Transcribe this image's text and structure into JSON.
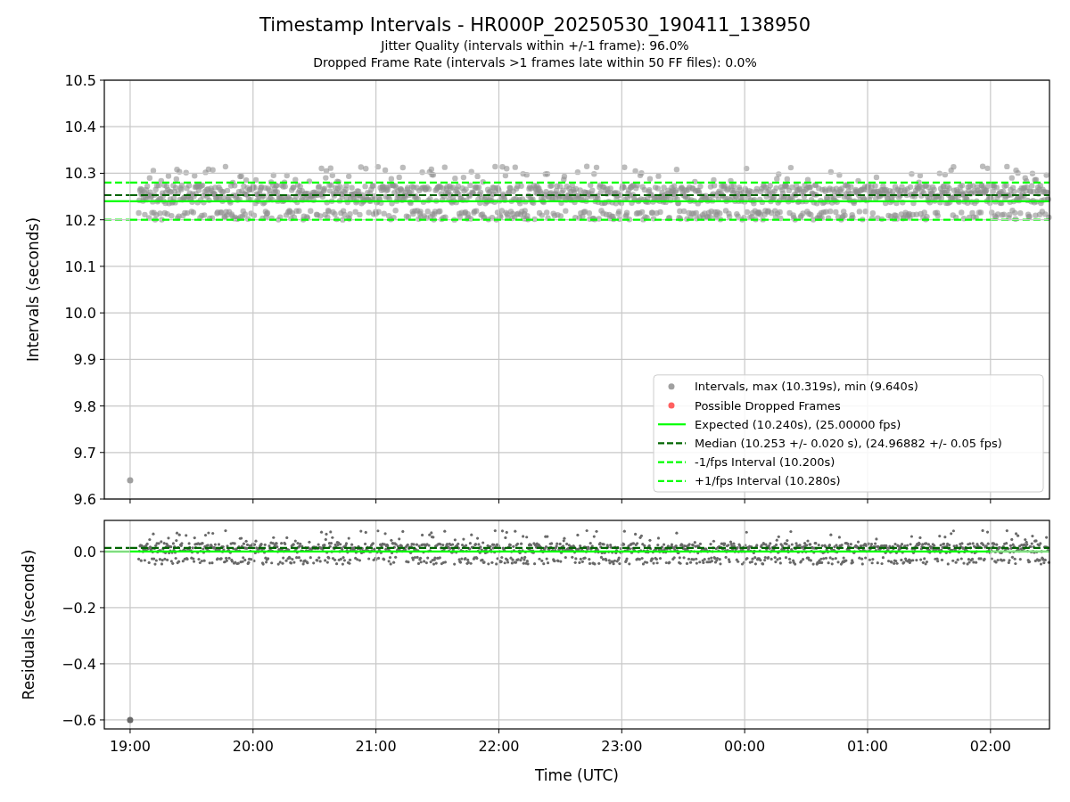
{
  "figure": {
    "title": "Timestamp Intervals - HR000P_20250530_190411_138950",
    "subtitles": [
      "Jitter Quality (intervals within +/-1 frame): 96.0%",
      "Dropped Frame Rate (intervals >1 frames late within 50 FF files): 0.0%"
    ]
  },
  "intervals_plot": {
    "chart_data": {
      "type": "scatter",
      "ylabel": "Intervals (seconds)",
      "grid": true,
      "legend": "lower right",
      "categories": [
        null,
        null,
        null,
        null,
        null,
        null,
        null,
        null
      ],
      "ylim": [
        9.6,
        10.5
      ],
      "yticks": [
        {
          "value": 9.6,
          "label": "9.6"
        },
        {
          "value": 9.7,
          "label": "9.7"
        },
        {
          "value": 9.8,
          "label": "9.8"
        },
        {
          "value": 9.9,
          "label": "9.9"
        },
        {
          "value": 10.0,
          "label": "10.0"
        },
        {
          "value": 10.1,
          "label": "10.1"
        },
        {
          "value": 10.2,
          "label": "10.2"
        },
        {
          "value": 10.3,
          "label": "10.3"
        },
        {
          "value": 10.4,
          "label": "10.4"
        },
        {
          "value": 10.5,
          "label": "10.5"
        }
      ],
      "series": [
        {
          "name": "Intervals, max (10.319s), min (9.640s)",
          "type": "scatter",
          "color": "#a0a0a0",
          "values": [
            9.64,
            null,
            null,
            null,
            null,
            null,
            null,
            null
          ]
        },
        {
          "name": "Possible Dropped Frames",
          "type": "scatter",
          "color": "#ff6060",
          "values": [
            null,
            null,
            null,
            null,
            null,
            null,
            null,
            null
          ]
        },
        {
          "name": "Expected (10.240s), (25.00000 fps)",
          "type": "line",
          "color": "#00ff00",
          "values": [
            10.24,
            10.24,
            10.24,
            10.24,
            10.24,
            10.24,
            10.24,
            10.24
          ]
        },
        {
          "name": "Median (10.253 +/- 0.020 s), (24.96882 +/- 0.05 fps)",
          "type": "line",
          "line_style": "dashed",
          "color": "#006400",
          "values": [
            10.253,
            10.253,
            10.253,
            10.253,
            10.253,
            10.253,
            10.253,
            10.253
          ]
        },
        {
          "name": "-1/fps Interval (10.200s)",
          "type": "line",
          "line_style": "dashed",
          "color": "#00ff00",
          "values": [
            10.2,
            10.2,
            10.2,
            10.2,
            10.2,
            10.2,
            10.2,
            10.2
          ]
        },
        {
          "name": "+1/fps Interval (10.280s)",
          "type": "line",
          "line_style": "dashed",
          "color": "#00ff00",
          "values": [
            10.28,
            10.28,
            10.28,
            10.28,
            10.28,
            10.28,
            10.28,
            10.28
          ]
        }
      ]
    }
  },
  "residuals_plot": {
    "chart_data": {
      "type": "scatter",
      "ylabel": "Residuals (seconds)",
      "xlabel": "Time (UTC)",
      "grid": true,
      "categories": [
        "19:00",
        "20:00",
        "21:00",
        "22:00",
        "23:00",
        "00:00",
        "01:00",
        "02:00"
      ],
      "ylim": [
        -0.632,
        0.111
      ],
      "yticks": [
        {
          "value": -0.6,
          "label": "−0.6"
        },
        {
          "value": -0.4,
          "label": "−0.4"
        },
        {
          "value": -0.2,
          "label": "−0.2"
        },
        {
          "value": 0,
          "label": "0.0"
        }
      ],
      "series": [
        {
          "type": "scatter",
          "color": "#696969",
          "values": [
            -0.6,
            null,
            null,
            null,
            null,
            null,
            null,
            null
          ]
        },
        {
          "type": "line",
          "color": "#00ff00",
          "values": [
            0,
            0,
            0,
            0,
            0,
            0,
            0,
            0
          ]
        },
        {
          "type": "line",
          "line_style": "dashed",
          "color": "#006400",
          "values": [
            0.013,
            0.013,
            0.013,
            0.013,
            0.013,
            0.013,
            0.013,
            0.013
          ]
        }
      ]
    }
  }
}
